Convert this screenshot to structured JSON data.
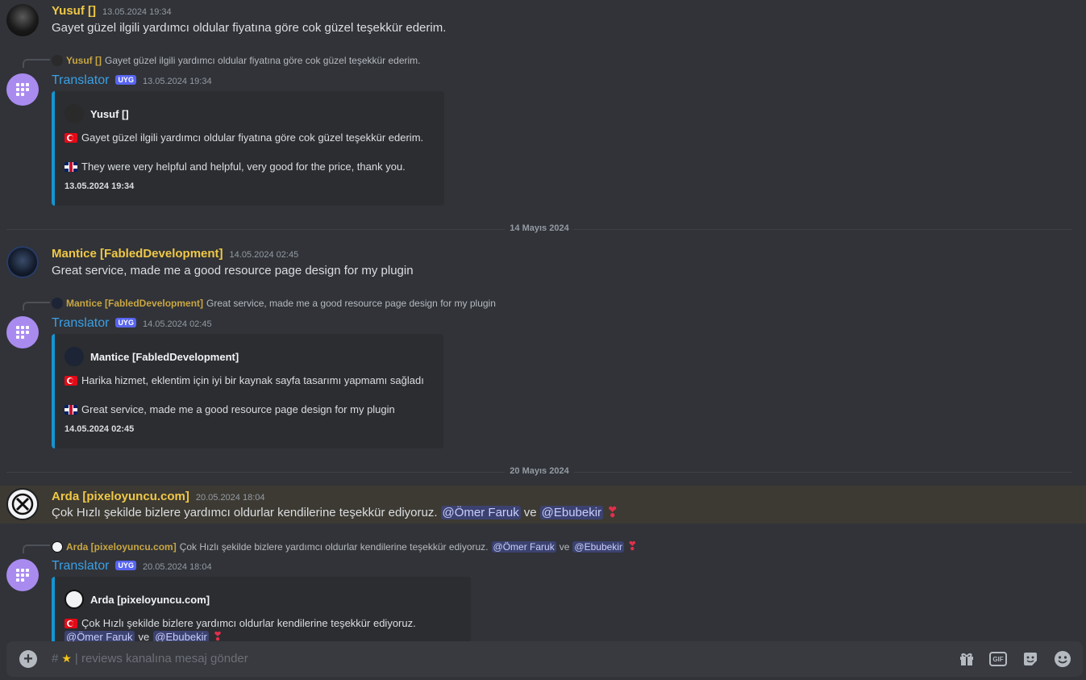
{
  "messages": [
    {
      "author": "Yusuf []",
      "time": "13.05.2024 19:34",
      "text": "Gayet güzel ilgili yardımcı oldular fiyatına göre cok güzel teşekkür ederim.",
      "translator": {
        "name": "Translator",
        "tag": "UYG",
        "time": "13.05.2024 19:34",
        "reply_author": "Yusuf []",
        "reply_text": "Gayet güzel ilgili yardımcı oldular fiyatına göre cok güzel teşekkür ederim.",
        "embed_author": "Yusuf []",
        "embed_tr": "Gayet güzel ilgili yardımcı oldular fiyatına göre cok güzel teşekkür ederim.",
        "embed_en": "They were very helpful and helpful, very good for the price, thank you.",
        "embed_footer": "13.05.2024 19:34"
      }
    },
    {
      "author": "Mantice [FabledDevelopment]",
      "time": "14.05.2024 02:45",
      "text": "Great service, made me a good resource page design for my plugin",
      "translator": {
        "name": "Translator",
        "tag": "UYG",
        "time": "14.05.2024 02:45",
        "reply_author": "Mantice [FabledDevelopment]",
        "reply_text": "Great service, made me a good resource page design for my plugin",
        "embed_author": "Mantice [FabledDevelopment]",
        "embed_tr": "Harika hizmet, eklentim için iyi bir kaynak sayfa tasarımı yapmamı sağladı",
        "embed_en": "Great service, made me a good resource page design for my plugin",
        "embed_footer": "14.05.2024 02:45"
      }
    },
    {
      "author": "Arda [pixeloyuncu.com]",
      "time": "20.05.2024 18:04",
      "text": "Çok Hızlı şekilde bizlere yardımcı oldurlar kendilerine teşekkür ediyoruz.",
      "mention1": "@Ömer Faruk",
      "conj": "ve",
      "mention2": "@Ebubekir",
      "translator": {
        "name": "Translator",
        "tag": "UYG",
        "time": "20.05.2024 18:04",
        "reply_author": "Arda [pixeloyuncu.com]",
        "reply_text": "Çok Hızlı şekilde bizlere yardımcı oldurlar kendilerine teşekkür ediyoruz.",
        "embed_author": "Arda [pixeloyuncu.com]",
        "embed_tr": "Çok Hızlı şekilde bizlere yardımcı oldurlar kendilerine teşekkür ediyoruz."
      }
    }
  ],
  "dividers": [
    "14 Mayıs 2024",
    "20 Mayıs 2024"
  ],
  "composer": {
    "hash": "#",
    "placeholder": "| reviews kanalına mesaj gönder",
    "gif_label": "GIF"
  },
  "colors": {
    "background": "#313338",
    "username_gold": "#f0c846",
    "translator_blue": "#3aa0e6",
    "embed_border": "#1694d2",
    "mention_bg": "#3c4270",
    "highlight_bg": "#3d3a33"
  },
  "icons": [
    "add-attachment-icon",
    "gift-icon",
    "gif-icon",
    "sticker-icon",
    "emoji-icon",
    "star-emoji-icon",
    "heart-emoji-icon",
    "flag-tr-icon",
    "flag-gb-icon",
    "app-grid-icon"
  ]
}
